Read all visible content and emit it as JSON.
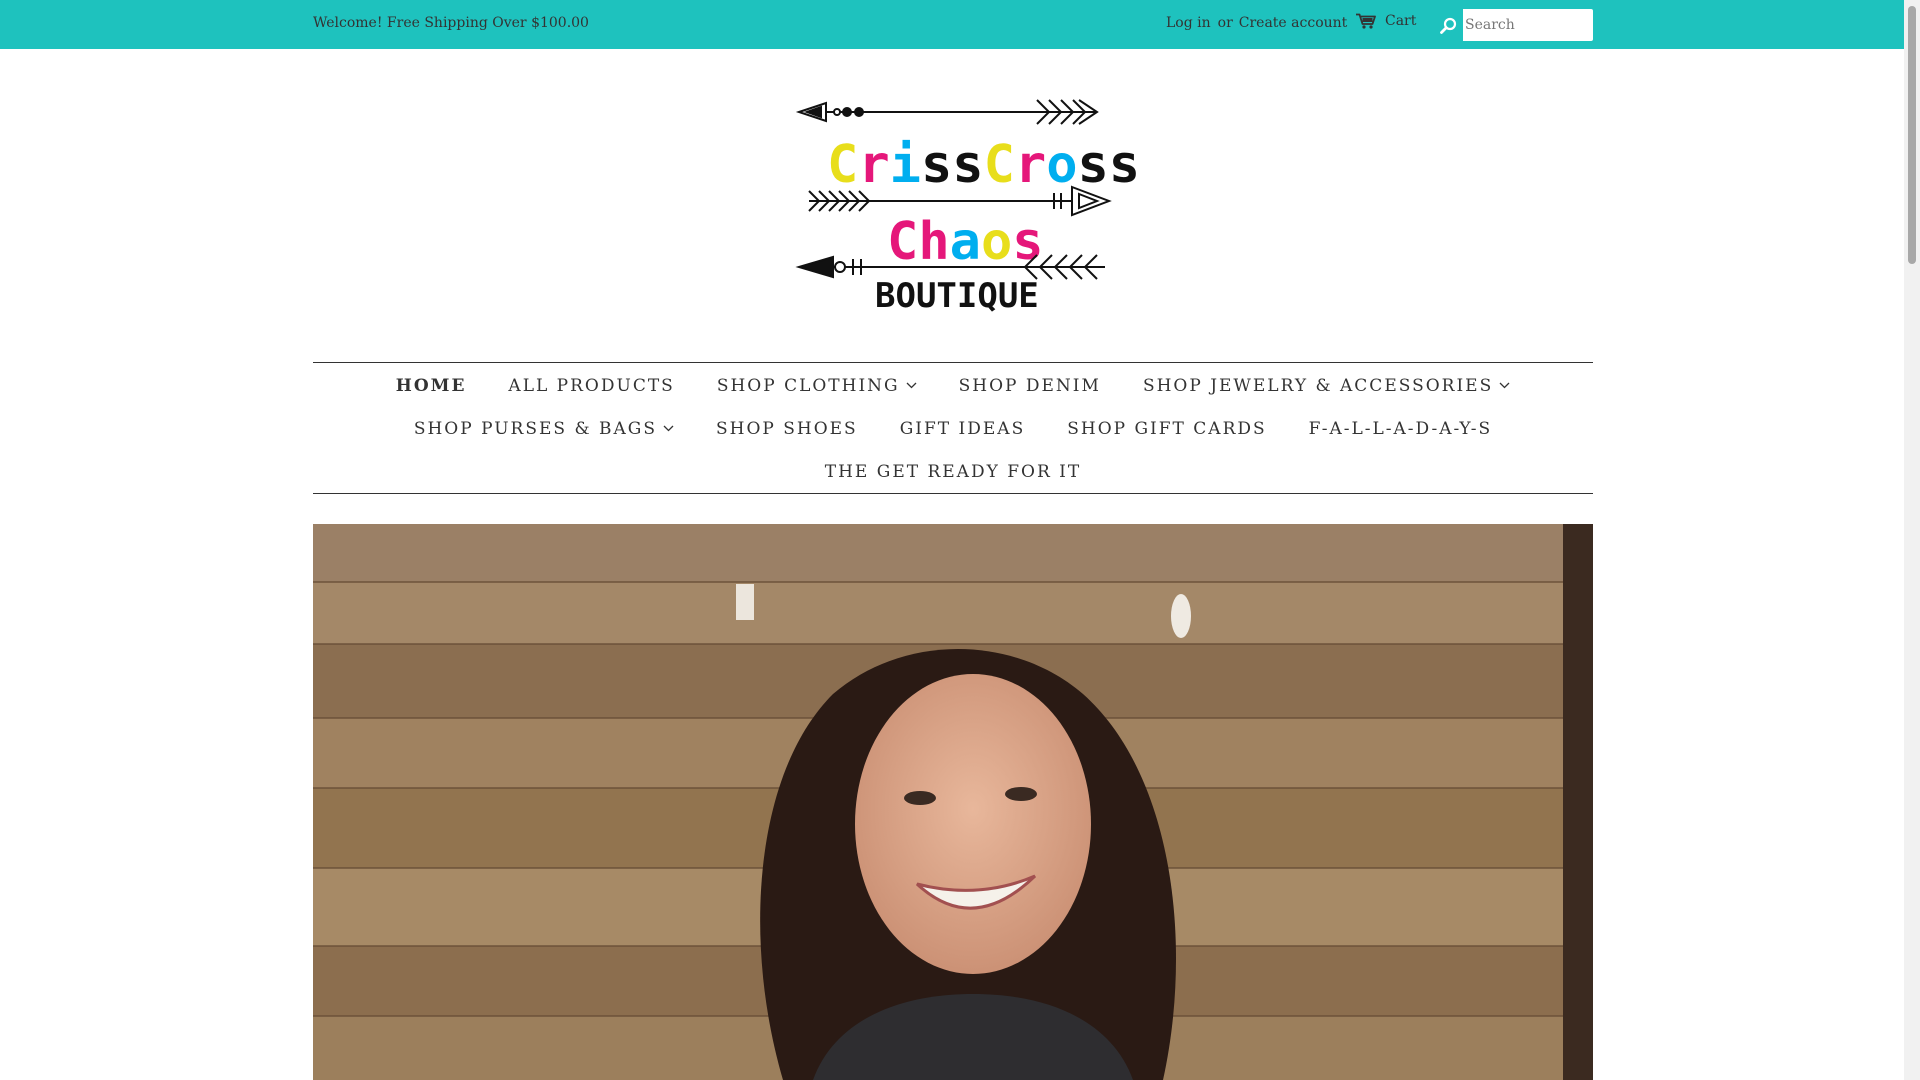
{
  "announcement": {
    "text": "Welcome! Free Shipping Over $100.00"
  },
  "account": {
    "login_label": "Log in",
    "or_label": "or",
    "create_label": "Create account"
  },
  "cart": {
    "label": "Cart",
    "icon": "cart-icon"
  },
  "search": {
    "placeholder": "Search",
    "value": "",
    "icon": "search-icon"
  },
  "brand": {
    "logo_lines": [
      "CrissCross",
      "Chaos",
      "BOUTIQUE"
    ],
    "logo_colors": [
      "#f2e600",
      "#e5177a",
      "#00aeef",
      "#111111"
    ]
  },
  "nav": {
    "row1": [
      {
        "label": "HOME",
        "active": true,
        "dropdown": false
      },
      {
        "label": "ALL PRODUCTS",
        "active": false,
        "dropdown": false
      },
      {
        "label": "SHOP CLOTHING",
        "active": false,
        "dropdown": true
      },
      {
        "label": "SHOP DENIM",
        "active": false,
        "dropdown": false
      },
      {
        "label": "SHOP JEWELRY & ACCESSORIES",
        "active": false,
        "dropdown": true
      }
    ],
    "row2": [
      {
        "label": "SHOP PURSES & BAGS",
        "active": false,
        "dropdown": true
      },
      {
        "label": "SHOP SHOES",
        "active": false,
        "dropdown": false
      },
      {
        "label": "GIFT IDEAS",
        "active": false,
        "dropdown": false
      },
      {
        "label": "SHOP GIFT CARDS",
        "active": false,
        "dropdown": false
      },
      {
        "label": "F-A-L-L-A-D-A-Y-S",
        "active": false,
        "dropdown": false
      }
    ],
    "row3": [
      {
        "label": "THE GET READY FOR IT",
        "active": false,
        "dropdown": false
      }
    ]
  },
  "colors": {
    "topbar": "#1ec2be",
    "text": "#333333",
    "background": "#ffffff"
  }
}
